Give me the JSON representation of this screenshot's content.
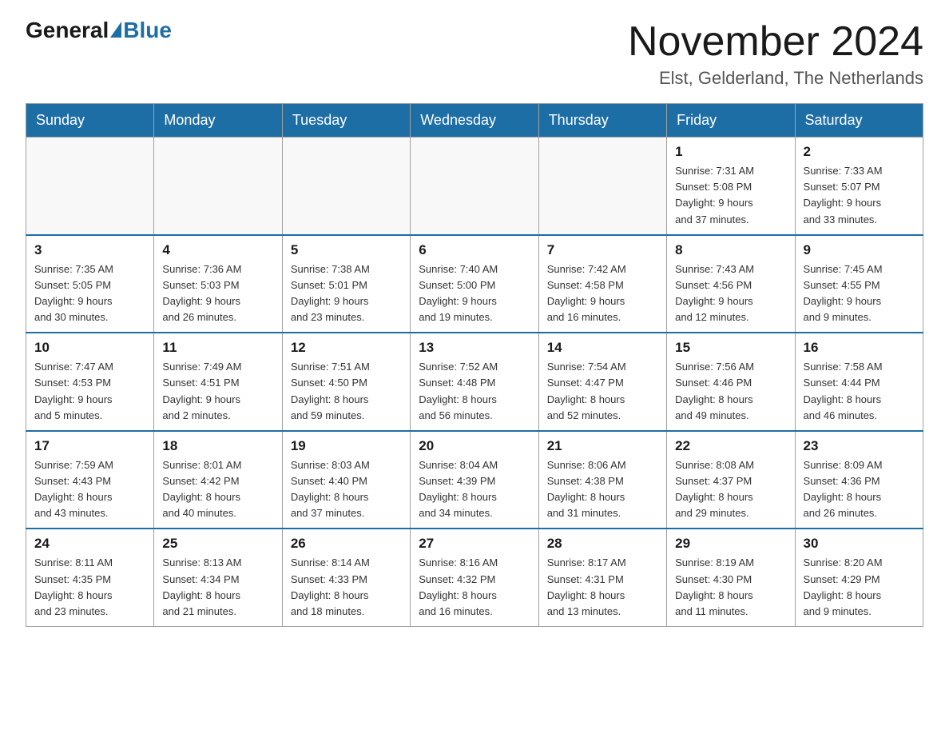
{
  "logo": {
    "general": "General",
    "blue": "Blue"
  },
  "title": "November 2024",
  "subtitle": "Elst, Gelderland, The Netherlands",
  "headers": [
    "Sunday",
    "Monday",
    "Tuesday",
    "Wednesday",
    "Thursday",
    "Friday",
    "Saturday"
  ],
  "weeks": [
    [
      {
        "day": "",
        "info": ""
      },
      {
        "day": "",
        "info": ""
      },
      {
        "day": "",
        "info": ""
      },
      {
        "day": "",
        "info": ""
      },
      {
        "day": "",
        "info": ""
      },
      {
        "day": "1",
        "info": "Sunrise: 7:31 AM\nSunset: 5:08 PM\nDaylight: 9 hours\nand 37 minutes."
      },
      {
        "day": "2",
        "info": "Sunrise: 7:33 AM\nSunset: 5:07 PM\nDaylight: 9 hours\nand 33 minutes."
      }
    ],
    [
      {
        "day": "3",
        "info": "Sunrise: 7:35 AM\nSunset: 5:05 PM\nDaylight: 9 hours\nand 30 minutes."
      },
      {
        "day": "4",
        "info": "Sunrise: 7:36 AM\nSunset: 5:03 PM\nDaylight: 9 hours\nand 26 minutes."
      },
      {
        "day": "5",
        "info": "Sunrise: 7:38 AM\nSunset: 5:01 PM\nDaylight: 9 hours\nand 23 minutes."
      },
      {
        "day": "6",
        "info": "Sunrise: 7:40 AM\nSunset: 5:00 PM\nDaylight: 9 hours\nand 19 minutes."
      },
      {
        "day": "7",
        "info": "Sunrise: 7:42 AM\nSunset: 4:58 PM\nDaylight: 9 hours\nand 16 minutes."
      },
      {
        "day": "8",
        "info": "Sunrise: 7:43 AM\nSunset: 4:56 PM\nDaylight: 9 hours\nand 12 minutes."
      },
      {
        "day": "9",
        "info": "Sunrise: 7:45 AM\nSunset: 4:55 PM\nDaylight: 9 hours\nand 9 minutes."
      }
    ],
    [
      {
        "day": "10",
        "info": "Sunrise: 7:47 AM\nSunset: 4:53 PM\nDaylight: 9 hours\nand 5 minutes."
      },
      {
        "day": "11",
        "info": "Sunrise: 7:49 AM\nSunset: 4:51 PM\nDaylight: 9 hours\nand 2 minutes."
      },
      {
        "day": "12",
        "info": "Sunrise: 7:51 AM\nSunset: 4:50 PM\nDaylight: 8 hours\nand 59 minutes."
      },
      {
        "day": "13",
        "info": "Sunrise: 7:52 AM\nSunset: 4:48 PM\nDaylight: 8 hours\nand 56 minutes."
      },
      {
        "day": "14",
        "info": "Sunrise: 7:54 AM\nSunset: 4:47 PM\nDaylight: 8 hours\nand 52 minutes."
      },
      {
        "day": "15",
        "info": "Sunrise: 7:56 AM\nSunset: 4:46 PM\nDaylight: 8 hours\nand 49 minutes."
      },
      {
        "day": "16",
        "info": "Sunrise: 7:58 AM\nSunset: 4:44 PM\nDaylight: 8 hours\nand 46 minutes."
      }
    ],
    [
      {
        "day": "17",
        "info": "Sunrise: 7:59 AM\nSunset: 4:43 PM\nDaylight: 8 hours\nand 43 minutes."
      },
      {
        "day": "18",
        "info": "Sunrise: 8:01 AM\nSunset: 4:42 PM\nDaylight: 8 hours\nand 40 minutes."
      },
      {
        "day": "19",
        "info": "Sunrise: 8:03 AM\nSunset: 4:40 PM\nDaylight: 8 hours\nand 37 minutes."
      },
      {
        "day": "20",
        "info": "Sunrise: 8:04 AM\nSunset: 4:39 PM\nDaylight: 8 hours\nand 34 minutes."
      },
      {
        "day": "21",
        "info": "Sunrise: 8:06 AM\nSunset: 4:38 PM\nDaylight: 8 hours\nand 31 minutes."
      },
      {
        "day": "22",
        "info": "Sunrise: 8:08 AM\nSunset: 4:37 PM\nDaylight: 8 hours\nand 29 minutes."
      },
      {
        "day": "23",
        "info": "Sunrise: 8:09 AM\nSunset: 4:36 PM\nDaylight: 8 hours\nand 26 minutes."
      }
    ],
    [
      {
        "day": "24",
        "info": "Sunrise: 8:11 AM\nSunset: 4:35 PM\nDaylight: 8 hours\nand 23 minutes."
      },
      {
        "day": "25",
        "info": "Sunrise: 8:13 AM\nSunset: 4:34 PM\nDaylight: 8 hours\nand 21 minutes."
      },
      {
        "day": "26",
        "info": "Sunrise: 8:14 AM\nSunset: 4:33 PM\nDaylight: 8 hours\nand 18 minutes."
      },
      {
        "day": "27",
        "info": "Sunrise: 8:16 AM\nSunset: 4:32 PM\nDaylight: 8 hours\nand 16 minutes."
      },
      {
        "day": "28",
        "info": "Sunrise: 8:17 AM\nSunset: 4:31 PM\nDaylight: 8 hours\nand 13 minutes."
      },
      {
        "day": "29",
        "info": "Sunrise: 8:19 AM\nSunset: 4:30 PM\nDaylight: 8 hours\nand 11 minutes."
      },
      {
        "day": "30",
        "info": "Sunrise: 8:20 AM\nSunset: 4:29 PM\nDaylight: 8 hours\nand 9 minutes."
      }
    ]
  ]
}
